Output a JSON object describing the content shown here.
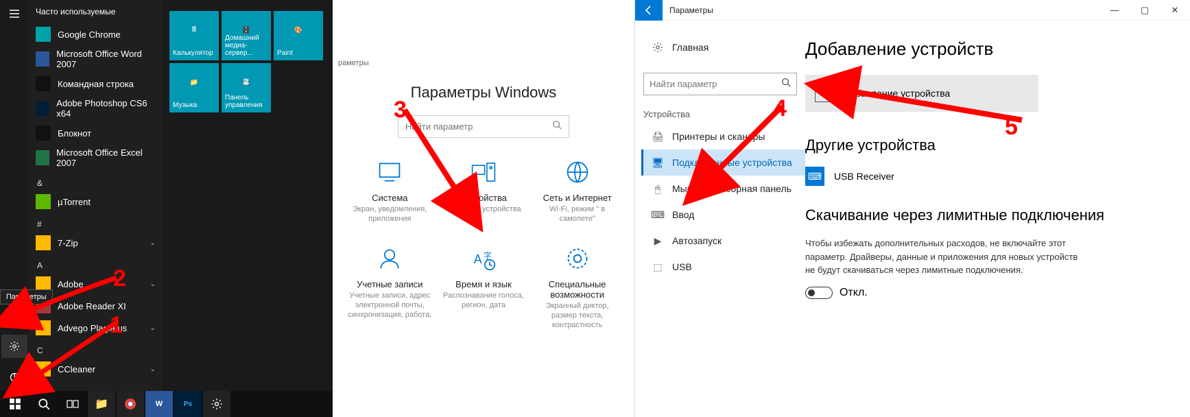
{
  "start_menu": {
    "header": "Часто используемые",
    "apps_frequent": [
      {
        "label": "Google Chrome",
        "icon_class": "teal"
      },
      {
        "label": "Microsoft Office Word 2007",
        "icon_class": "blue"
      },
      {
        "label": "Командная строка",
        "icon_class": "dark"
      },
      {
        "label": "Adobe Photoshop CS6 x64",
        "icon_class": "purple"
      },
      {
        "label": "Блокнот",
        "icon_class": "dark"
      },
      {
        "label": "Microsoft Office Excel 2007",
        "icon_class": "green"
      }
    ],
    "group_amp": [
      {
        "label": "µTorrent",
        "icon_class": "lime"
      }
    ],
    "group_hash": [
      {
        "label": "7-Zip",
        "icon_class": "folder",
        "expandable": true
      }
    ],
    "group_a": [
      {
        "label": "Adobe",
        "icon_class": "folder",
        "expandable": true
      },
      {
        "label": "Adobe Reader XI",
        "icon_class": "red"
      },
      {
        "label": "Advego Plagiatus",
        "icon_class": "folder",
        "expandable": true
      }
    ],
    "group_c": [
      {
        "label": "CCleaner",
        "icon_class": "folder",
        "expandable": true
      }
    ],
    "letters": {
      "amp": "&",
      "hash": "#",
      "a": "A",
      "c": "C"
    },
    "tiles": [
      {
        "label": "Калькулятор"
      },
      {
        "label": "Домашний медиа-сервер..."
      },
      {
        "label": "Paint"
      },
      {
        "label": "Музыка"
      },
      {
        "label": "Панель управления"
      }
    ],
    "gear_tooltip": "Параметры"
  },
  "settings_home": {
    "breadcrumb": "раметры",
    "title": "Параметры Windows",
    "search_placeholder": "Найти параметр",
    "categories": [
      {
        "name": "Система",
        "desc": "Экран, уведомления, приложения"
      },
      {
        "name": "Устройства",
        "desc": "Bluetooth, устройства"
      },
      {
        "name": "Сеть и Интернет",
        "desc": "Wi-Fi, режим \" в самолете\""
      },
      {
        "name": "Учетные записи",
        "desc": "Учетные записи, адрес электронной почты, синхронизация, работа,"
      },
      {
        "name": "Время и язык",
        "desc": "Распознавание голоса, регион, дата"
      },
      {
        "name": "Специальные возможности",
        "desc": "Экранный диктор, размер текста, контрастность"
      }
    ]
  },
  "devices": {
    "window_title": "Параметры",
    "side": {
      "home": "Главная",
      "search_placeholder": "Найти параметр",
      "section": "Устройства",
      "items": [
        "Принтеры и сканеры",
        "Подключенные устройства",
        "Мышь и сенсорная панель",
        "Ввод",
        "Автозапуск",
        "USB"
      ]
    },
    "main": {
      "h1": "Добавление устройств",
      "add_button": "Добавление устройства",
      "h2_other": "Другие устройства",
      "device0": "USB Receiver",
      "h2_metered": "Скачивание через лимитные подключения",
      "desc": "Чтобы избежать дополнительных расходов, не включайте этот параметр. Драйверы, данные и приложения для новых устройств не будут скачиваться через лимитные подключения.",
      "toggle_label": "Откл."
    }
  },
  "annotations": [
    "1",
    "2",
    "3",
    "4",
    "5"
  ]
}
